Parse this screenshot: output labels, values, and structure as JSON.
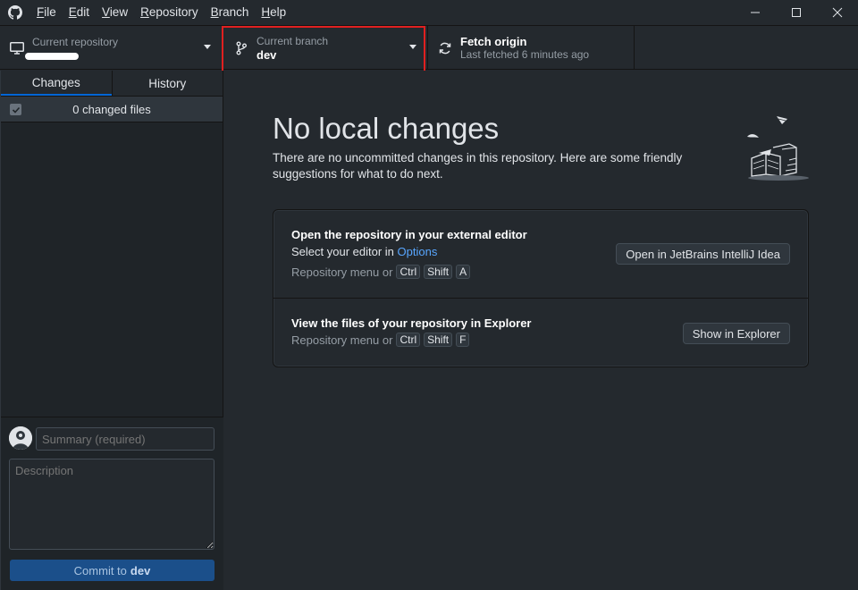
{
  "menu": {
    "items": [
      {
        "mnemonic": "F",
        "rest": "ile"
      },
      {
        "mnemonic": "E",
        "rest": "dit"
      },
      {
        "mnemonic": "V",
        "rest": "iew"
      },
      {
        "mnemonic": "R",
        "rest": "epository"
      },
      {
        "mnemonic": "B",
        "rest": "ranch"
      },
      {
        "mnemonic": "H",
        "rest": "elp"
      }
    ]
  },
  "toolbar": {
    "repo_label": "Current repository",
    "branch_label": "Current branch",
    "branch_value": "dev",
    "fetch_title": "Fetch origin",
    "fetch_sub": "Last fetched 6 minutes ago"
  },
  "sidebar": {
    "tabs": [
      "Changes",
      "History"
    ],
    "changes_count": "0 changed files",
    "summary_placeholder": "Summary (required)",
    "description_placeholder": "Description",
    "commit_prefix": "Commit to",
    "commit_branch": "dev"
  },
  "main": {
    "title": "No local changes",
    "description": "There are no uncommitted changes in this repository. Here are some friendly suggestions for what to do next.",
    "actions": [
      {
        "title": "Open the repository in your external editor",
        "text_prefix": "Select your editor in",
        "text_link": "Options",
        "hint_prefix": "Repository menu or",
        "keys": [
          "Ctrl",
          "Shift",
          "A"
        ],
        "button": "Open in JetBrains IntelliJ Idea"
      },
      {
        "title": "View the files of your repository in Explorer",
        "hint_prefix": "Repository menu or",
        "keys": [
          "Ctrl",
          "Shift",
          "F"
        ],
        "button": "Show in Explorer"
      }
    ]
  },
  "colors": {
    "accent": "#0366d6",
    "highlight": "#e02020",
    "link": "#58a6ff"
  }
}
